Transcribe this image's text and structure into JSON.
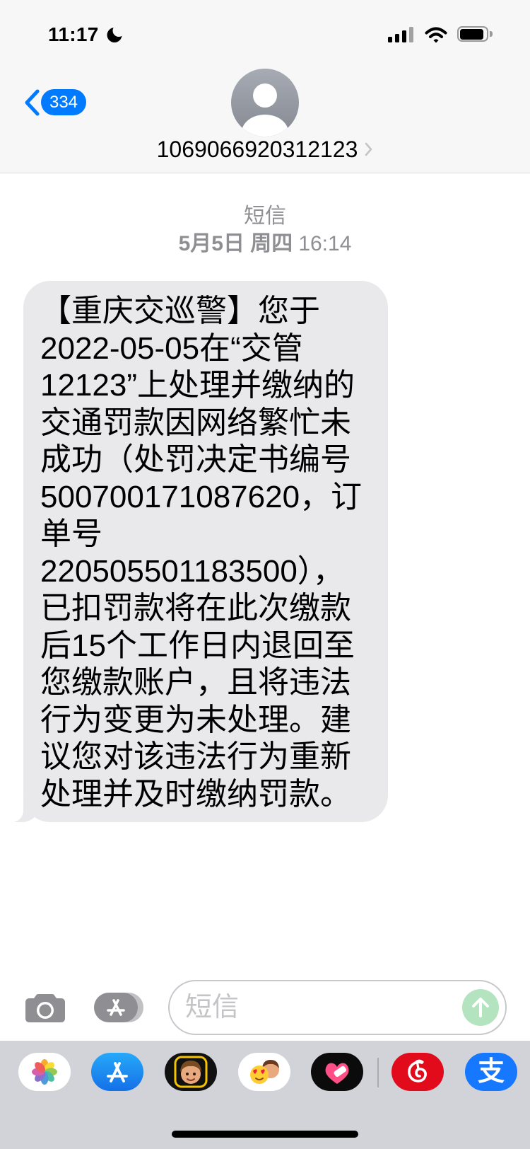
{
  "status_bar": {
    "time": "11:17",
    "focus_icon": "moon-icon",
    "signal_icon": "signal-icon",
    "wifi_icon": "wifi-icon",
    "battery_icon": "battery-icon",
    "battery_level": 0.9
  },
  "header": {
    "back_icon": "chevron-left-icon",
    "unread_count": "334",
    "avatar_icon": "person-icon",
    "sender": "1069066920312123",
    "sender_chevron_icon": "chevron-right-icon"
  },
  "thread": {
    "service_label": "短信",
    "date_label": "5月5日 周四",
    "time_label": "16:14"
  },
  "messages": [
    {
      "incoming": true,
      "lines": [
        "【重庆交巡警】您于",
        "2022-05-05在“交管",
        "12123”上处理并缴纳的",
        "交通罚款因网络繁忙未",
        "成功（处罚决定书编号",
        "500700171087620，订",
        "单号",
        "220505501183500），",
        "已扣罚款将在此次缴款",
        "后15个工作日内退回至",
        "您缴款账户，且将违法",
        "行为变更为未处理。建",
        "议您对该违法行为重新",
        "处理并及时缴纳罚款。"
      ]
    }
  ],
  "composer": {
    "camera_icon": "camera-icon",
    "apps_icon": "app-store-icon",
    "placeholder": "短信",
    "send_icon": "arrow-up-icon"
  },
  "app_drawer": {
    "apps": [
      {
        "icon": "photos-icon"
      },
      {
        "icon": "app-store-icon"
      },
      {
        "icon": "memoji-icon"
      },
      {
        "icon": "memoji-stickers-icon"
      },
      {
        "icon": "digital-touch-icon"
      },
      {
        "icon": "netease-cloud-music-icon"
      },
      {
        "icon": "alipay-icon",
        "glyph": "支"
      }
    ]
  },
  "colors": {
    "accent": "#007aff",
    "bubble": "#e9e9eb",
    "send_button": "#b4e3bf",
    "drawer": "#d1d3d9",
    "header": "#f7f7f7",
    "secondary_text": "#8e8e93"
  }
}
